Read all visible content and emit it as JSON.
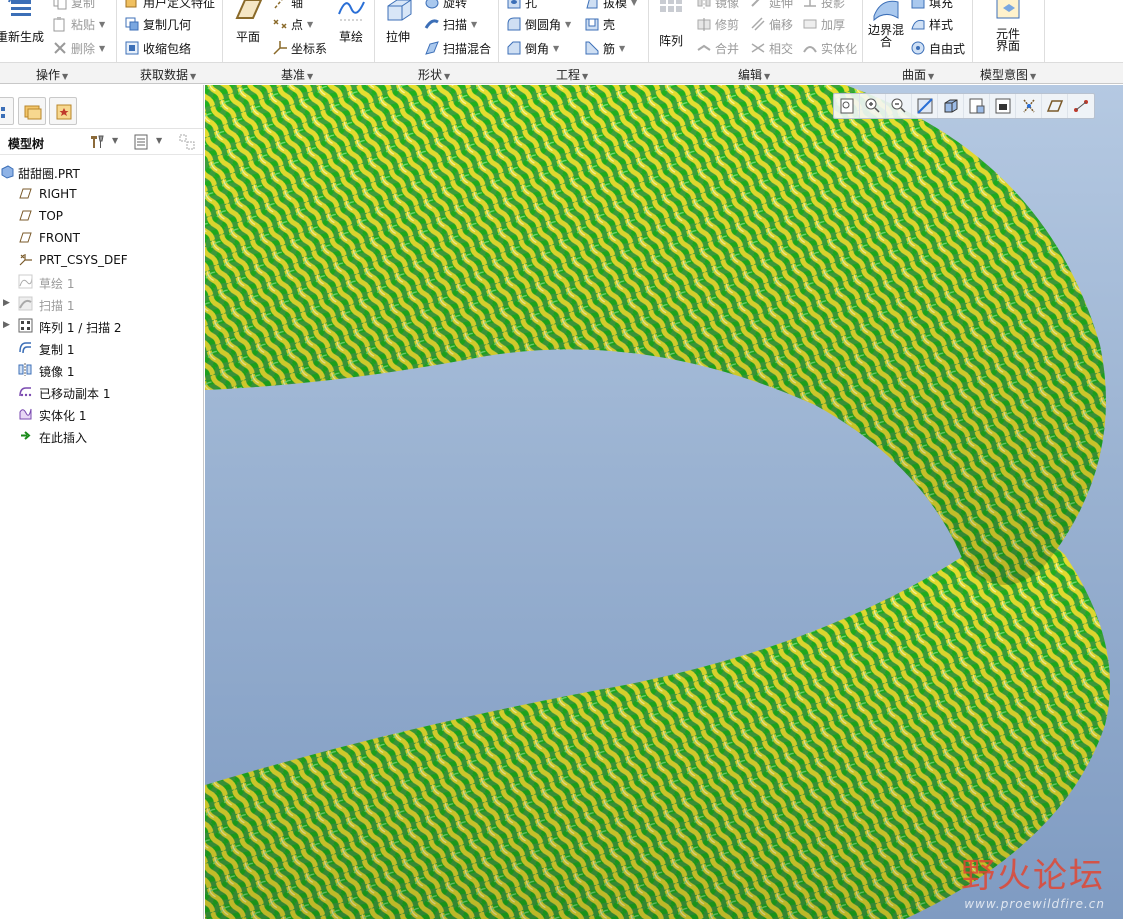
{
  "ribbon": {
    "operations": {
      "regen": "重新生成",
      "copy": "复制",
      "paste": "粘贴",
      "delete": "删除"
    },
    "get_data": {
      "udf": "用户定义特征",
      "copy_geom": "复制几何",
      "shrinkwrap": "收缩包络"
    },
    "datum": {
      "plane": "平面",
      "axis": "轴",
      "point": "点",
      "csys": "坐标系",
      "sketch": "草绘"
    },
    "shapes": {
      "extrude": "拉伸",
      "revolve": "旋转",
      "sweep": "扫描",
      "swept_blend": "扫描混合"
    },
    "engineering": {
      "hole": "孔",
      "round": "倒圆角",
      "chamfer": "倒角",
      "draft": "拔模",
      "shell": "壳",
      "rib": "筋"
    },
    "editing": {
      "pattern": "阵列",
      "mirror": "镜像",
      "trim": "修剪",
      "merge": "合并",
      "extend": "延伸",
      "offset": "偏移",
      "intersect": "相交",
      "project": "投影",
      "thicken": "加厚",
      "solidify": "实体化"
    },
    "surfaces": {
      "fill": "填充",
      "boundary_blend": "边界混合",
      "style": "样式",
      "freestyle": "自由式"
    },
    "model_intent": {
      "component_interface": "元件界面"
    }
  },
  "groups": [
    "操作",
    "获取数据",
    "基准",
    "形状",
    "工程",
    "编辑",
    "曲面",
    "模型意图"
  ],
  "model_tree": {
    "title": "模型树",
    "items": [
      {
        "label": "甜甜圈.PRT"
      },
      {
        "label": "RIGHT"
      },
      {
        "label": "TOP"
      },
      {
        "label": "FRONT"
      },
      {
        "label": "PRT_CSYS_DEF"
      },
      {
        "label": "草绘 1"
      },
      {
        "label": "扫描 1"
      },
      {
        "label": "阵列 1 / 扫描 2"
      },
      {
        "label": "复制 1"
      },
      {
        "label": "镜像 1"
      },
      {
        "label": "已移动副本 1"
      },
      {
        "label": "实体化 1"
      },
      {
        "label": "在此插入"
      }
    ]
  },
  "watermark": {
    "title": "野火论坛",
    "url": "www.proewildfire.cn"
  },
  "colors": {
    "yarn_yellow": "#e8e23a",
    "yarn_green": "#18b418",
    "viewport_top": "#b5c9e2",
    "viewport_bottom": "#7f9bc2",
    "accent": "#2a6fd6"
  },
  "icons": [
    "regenerate-icon",
    "copy-icon",
    "paste-icon",
    "delete-icon",
    "udf-icon",
    "copy-geometry-icon",
    "shrinkwrap-icon",
    "plane-icon",
    "axis-icon",
    "point-icon",
    "csys-icon",
    "sketch-icon",
    "extrude-icon",
    "revolve-icon",
    "sweep-icon",
    "swept-blend-icon",
    "hole-icon",
    "round-icon",
    "chamfer-icon",
    "draft-icon",
    "shell-icon",
    "rib-icon",
    "pattern-icon",
    "mirror-icon",
    "trim-icon",
    "merge-icon",
    "extend-icon",
    "offset-icon",
    "intersect-icon",
    "project-icon",
    "thicken-icon",
    "solidify-icon",
    "boundary-blend-icon",
    "fill-icon",
    "style-icon",
    "freestyle-icon",
    "component-interface-icon"
  ]
}
